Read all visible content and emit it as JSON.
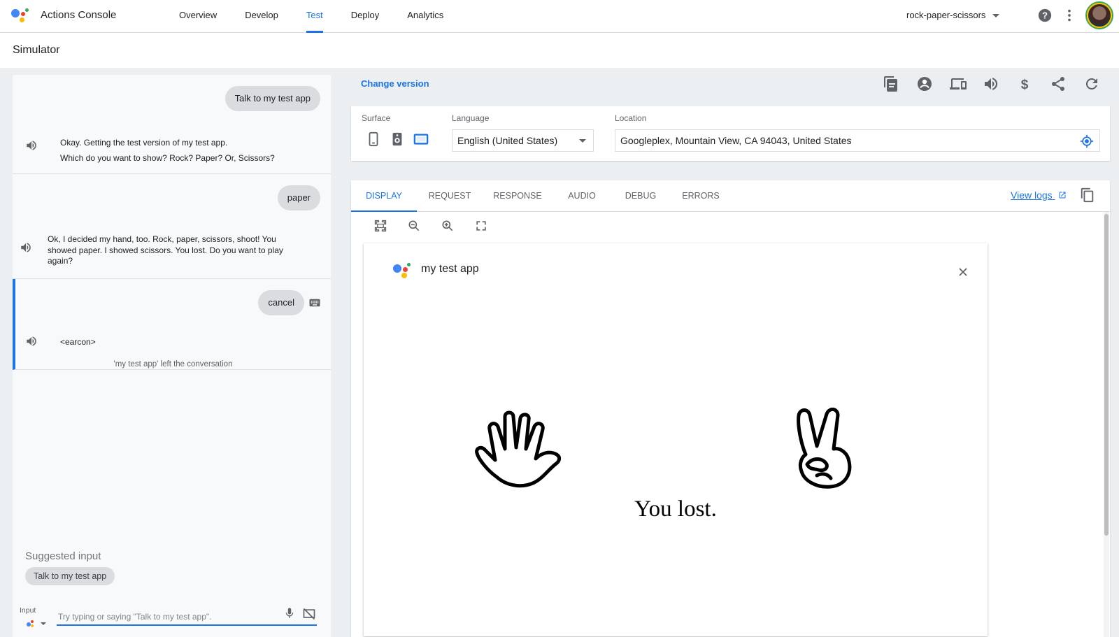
{
  "header": {
    "app_title": "Actions Console",
    "nav": [
      {
        "label": "Overview"
      },
      {
        "label": "Develop"
      },
      {
        "label": "Test",
        "active": true
      },
      {
        "label": "Deploy"
      },
      {
        "label": "Analytics"
      }
    ],
    "project": "rock-paper-scissors",
    "icons": [
      "help-icon",
      "more-vert-icon",
      "avatar"
    ]
  },
  "page": {
    "title": "Simulator"
  },
  "conversation": {
    "turns": [
      {
        "user": "Talk to my test app",
        "response_lines": [
          "Okay. Getting the test version of my test app.",
          "Which do you want to show? Rock? Paper? Or, Scissors?"
        ]
      },
      {
        "user": "paper",
        "response": "Ok, I decided my hand, too. Rock, paper, scissors, shoot! You showed paper. I showed scissors. You lost. Do you want to play again?"
      },
      {
        "user": "cancel",
        "response": "<earcon>",
        "note": "'my test app' left the conversation"
      }
    ],
    "suggested_title": "Suggested input",
    "suggestion": "Talk to my test app",
    "input_label": "Input",
    "input_placeholder": "Try typing or saying \"Talk to my test app\"."
  },
  "simulator": {
    "change_version": "Change version",
    "toolbar_icons": [
      "document-icon",
      "account-icon",
      "devices-icon",
      "volume-icon",
      "dollar-icon",
      "share-icon",
      "refresh-icon"
    ],
    "surface_label": "Surface",
    "surfaces": [
      "phone-icon",
      "speaker-icon",
      "smart-display-icon"
    ],
    "selected_surface": "smart-display-icon",
    "language_label": "Language",
    "language": "English (United States)",
    "location_label": "Location",
    "location": "Googleplex, Mountain View, CA 94043, United States",
    "tabs": [
      "DISPLAY",
      "REQUEST",
      "RESPONSE",
      "AUDIO",
      "DEBUG",
      "ERRORS"
    ],
    "active_tab": "DISPLAY",
    "view_logs": "View logs",
    "zoom_icons": [
      "fit-screen-icon",
      "zoom-out-icon",
      "zoom-in-icon",
      "fullscreen-icon"
    ]
  },
  "display": {
    "app_name": "my test app",
    "user_hand": "paper",
    "assistant_hand": "scissors",
    "result": "You lost."
  },
  "colors": {
    "accent": "#1a73e8",
    "google_blue": "#4285f4",
    "google_red": "#ea4335",
    "google_yellow": "#fbbc04",
    "google_green": "#34a853"
  }
}
